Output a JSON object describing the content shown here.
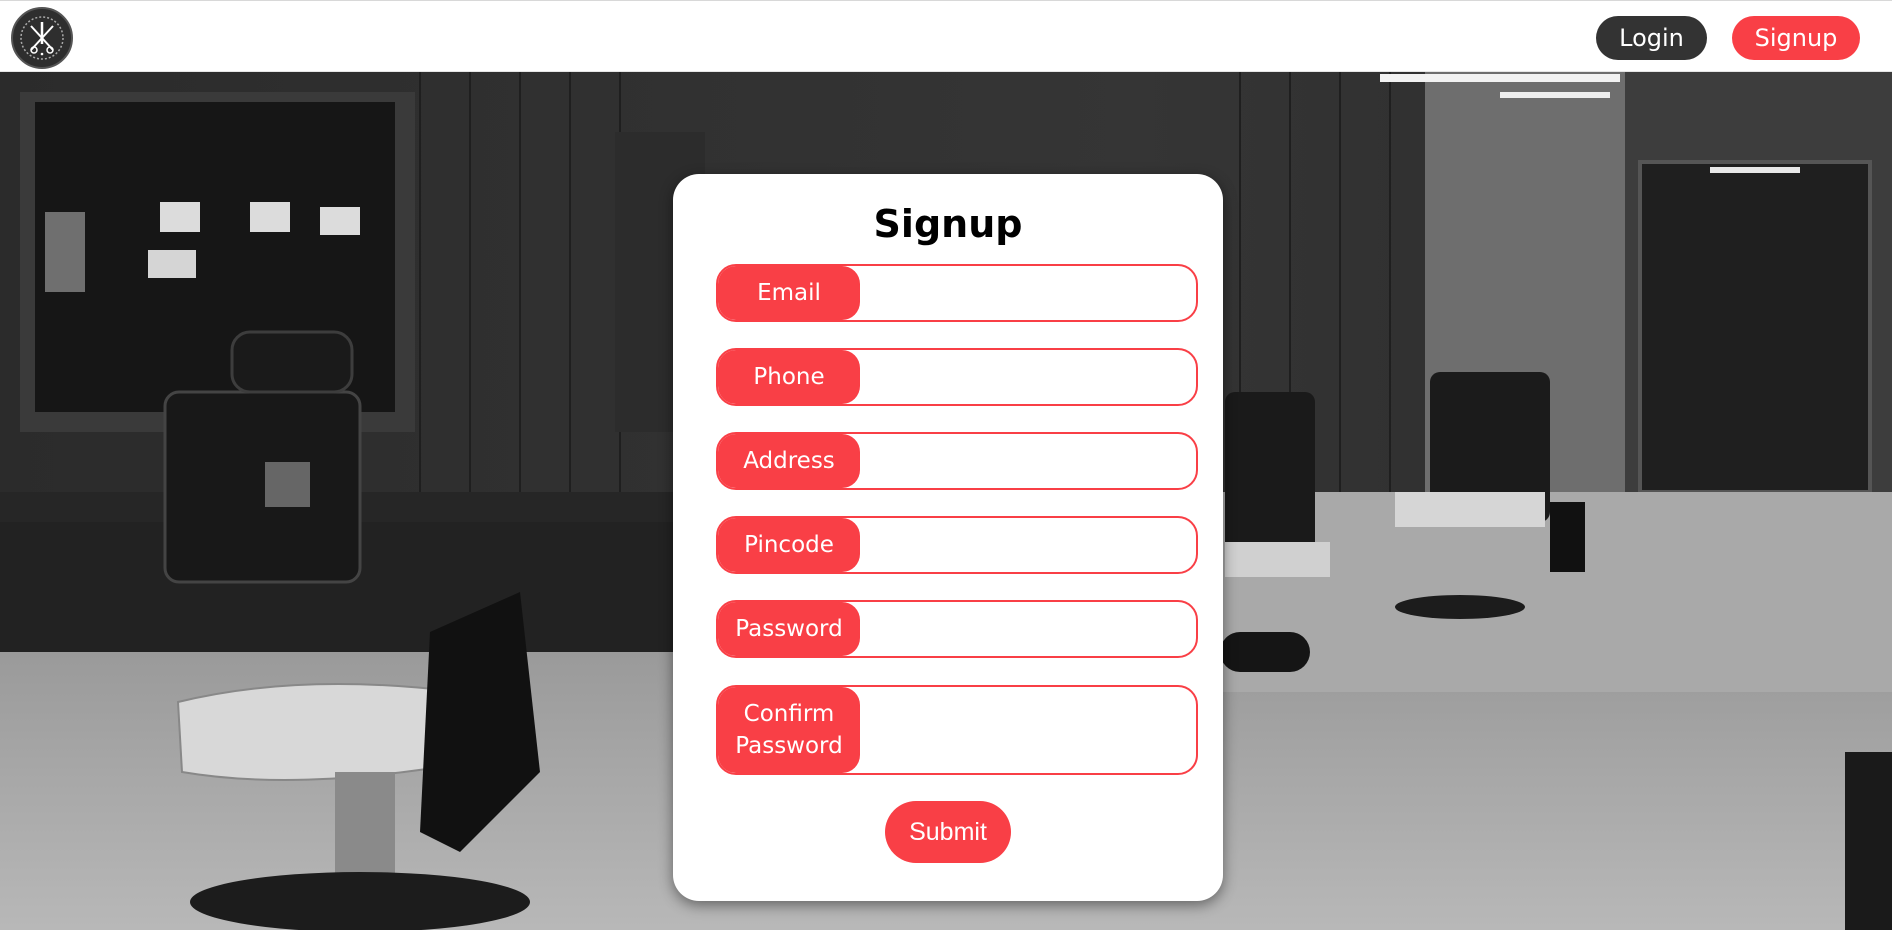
{
  "header": {
    "login_label": "Login",
    "signup_label": "Signup"
  },
  "form": {
    "title": "Signup",
    "fields": [
      {
        "label": "Email",
        "value": ""
      },
      {
        "label": "Phone",
        "value": ""
      },
      {
        "label": "Address",
        "value": ""
      },
      {
        "label": "Pincode",
        "value": ""
      },
      {
        "label": "Password",
        "value": ""
      },
      {
        "label": "Confirm Password",
        "value": ""
      }
    ],
    "submit_label": "Submit"
  },
  "colors": {
    "accent": "#f93f46",
    "dark_button": "#333333"
  },
  "icons": {
    "logo": "barber-scissors-razor-logo"
  }
}
